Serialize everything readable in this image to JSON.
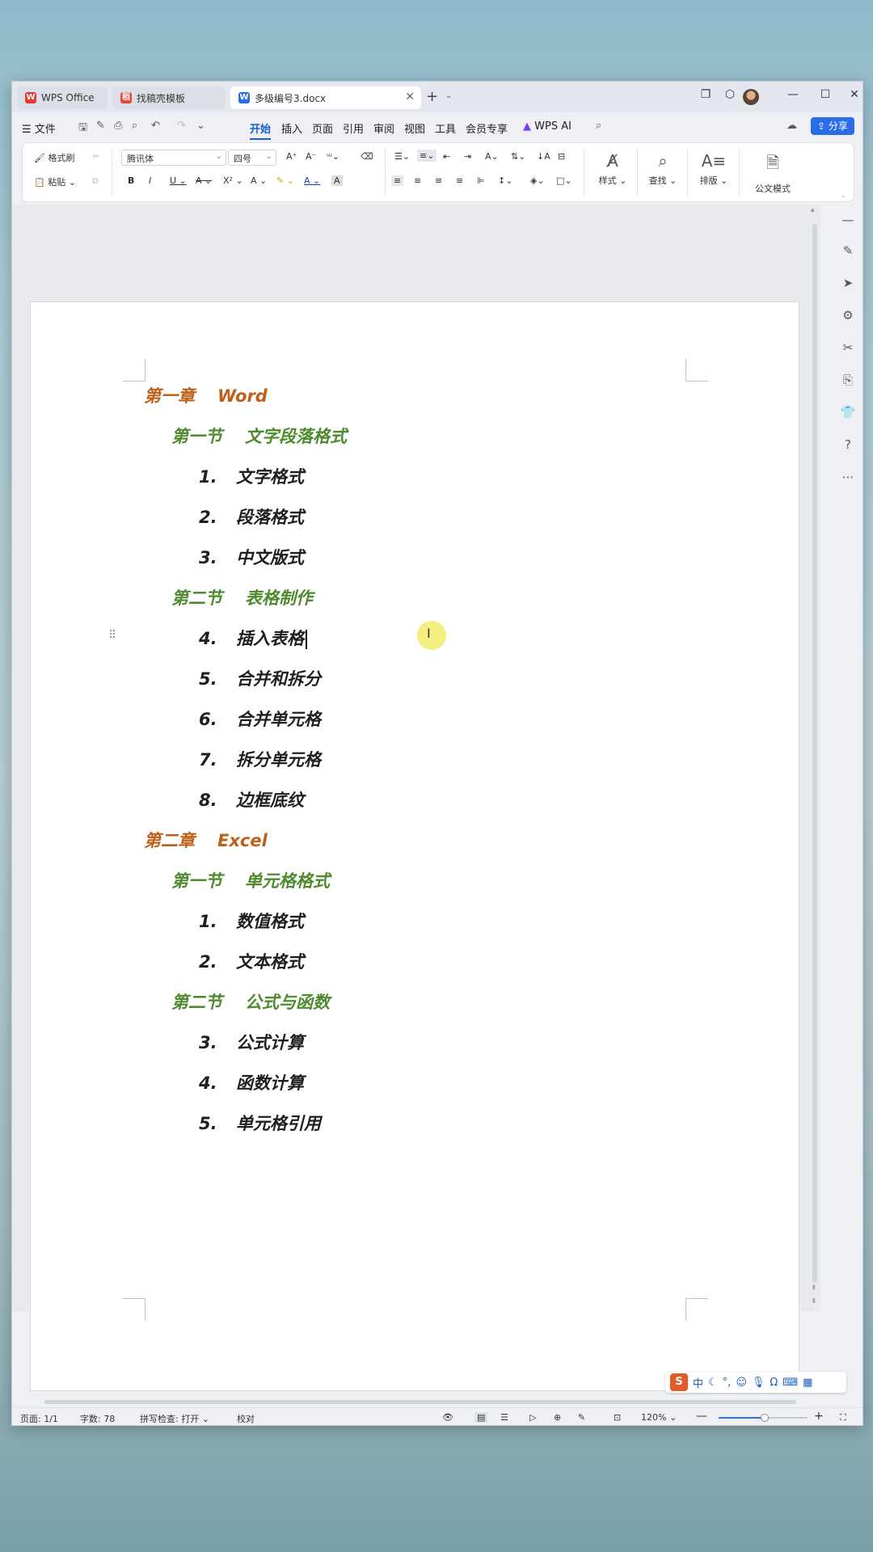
{
  "tabs": [
    {
      "label": "WPS Office",
      "icon": "wps-logo-icon"
    },
    {
      "label": "找稿壳模板",
      "icon": "template-icon"
    },
    {
      "label": "多级编号3.docx",
      "icon": "word-doc-icon"
    }
  ],
  "menu": {
    "file": "文件",
    "items": [
      "开始",
      "插入",
      "页面",
      "引用",
      "审阅",
      "视图",
      "工具",
      "会员专享"
    ],
    "active": "开始",
    "wps_ai": "WPS AI",
    "share": "分享"
  },
  "ribbon": {
    "format_painter": "格式刷",
    "paste": "粘贴",
    "font_name": "腾讯体",
    "font_size": "四号",
    "styles": "样式",
    "find": "查找",
    "layout": "排版",
    "official": "公文模式"
  },
  "document": {
    "lines": [
      {
        "type": "chapter",
        "prefix": "第一章",
        "text": "Word"
      },
      {
        "type": "section",
        "prefix": "第一节",
        "text": "文字段落格式"
      },
      {
        "type": "item",
        "num": "1.",
        "text": "文字格式"
      },
      {
        "type": "item",
        "num": "2.",
        "text": "段落格式"
      },
      {
        "type": "item",
        "num": "3.",
        "text": "中文版式"
      },
      {
        "type": "section",
        "prefix": "第二节",
        "text": "表格制作"
      },
      {
        "type": "item",
        "num": "4.",
        "text": "插入表格",
        "cursor": true
      },
      {
        "type": "item",
        "num": "5.",
        "text": "合并和拆分"
      },
      {
        "type": "item",
        "num": "6.",
        "text": "合并单元格"
      },
      {
        "type": "item",
        "num": "7.",
        "text": "拆分单元格"
      },
      {
        "type": "item",
        "num": "8.",
        "text": "边框底纹"
      },
      {
        "type": "chapter",
        "prefix": "第二章",
        "text": "Excel"
      },
      {
        "type": "section",
        "prefix": "第一节",
        "text": "单元格格式"
      },
      {
        "type": "item",
        "num": "1.",
        "text": "数值格式"
      },
      {
        "type": "item",
        "num": "2.",
        "text": "文本格式"
      },
      {
        "type": "section",
        "prefix": "第二节",
        "text": "公式与函数"
      },
      {
        "type": "item",
        "num": "3.",
        "text": "公式计算"
      },
      {
        "type": "item",
        "num": "4.",
        "text": "函数计算"
      },
      {
        "type": "item",
        "num": "5.",
        "text": "单元格引用"
      }
    ]
  },
  "ime": {
    "mode": "中"
  },
  "status": {
    "page": "页面: 1/1",
    "words": "字数: 78",
    "spell": "拼写检查: 打开",
    "proof": "校对",
    "zoom": "120%"
  },
  "colors": {
    "chapter": "#c06018",
    "section": "#4f8b2e",
    "accent": "#2b6de8"
  }
}
